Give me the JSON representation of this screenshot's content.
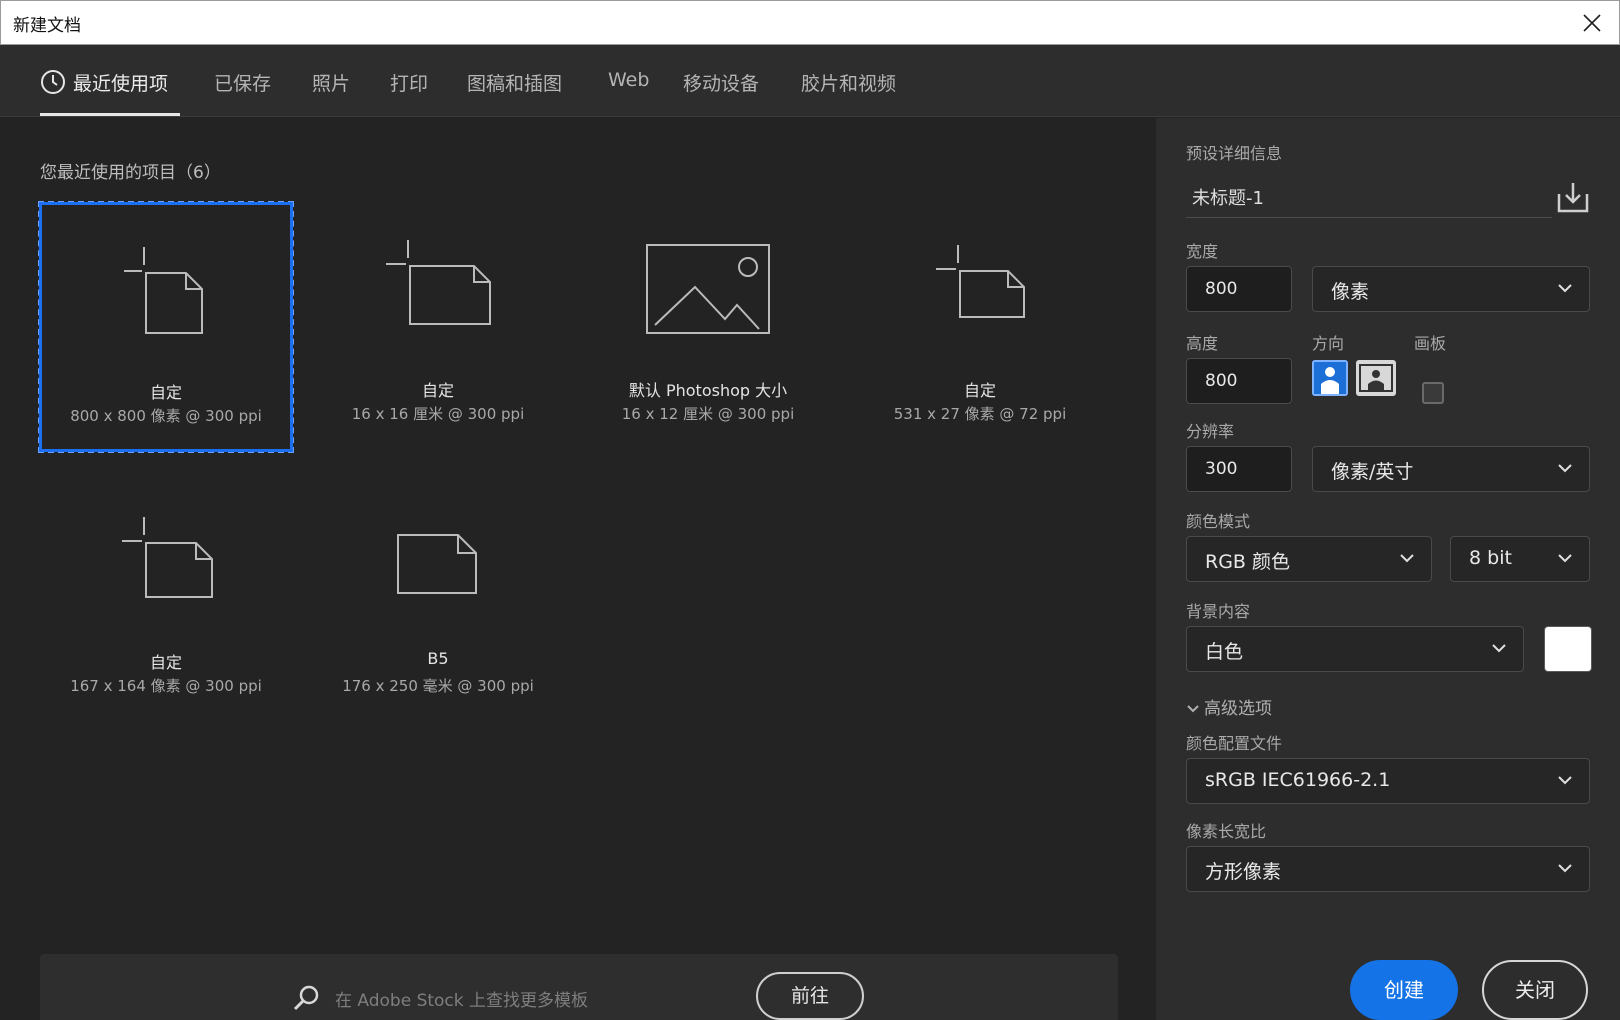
{
  "window": {
    "title": "新建文档"
  },
  "tabs": [
    "最近使用项",
    "已保存",
    "照片",
    "打印",
    "图稿和插图",
    "Web",
    "移动设备",
    "胶片和视频"
  ],
  "recent": {
    "heading": "您最近使用的项目（6）",
    "items": [
      {
        "name": "自定",
        "size": "800 x 800 像素 @ 300 ppi",
        "icon": "custom-document-icon"
      },
      {
        "name": "自定",
        "size": "16 x 16 厘米 @ 300 ppi",
        "icon": "custom-document-icon"
      },
      {
        "name": "默认 Photoshop 大小",
        "size": "16 x 12 厘米 @ 300 ppi",
        "icon": "image-placeholder-icon"
      },
      {
        "name": "自定",
        "size": "531 x 27 像素 @ 72 ppi",
        "icon": "custom-document-icon"
      },
      {
        "name": "自定",
        "size": "167 x 164 像素 @ 300 ppi",
        "icon": "custom-document-icon"
      },
      {
        "name": "B5",
        "size": "176 x 250 毫米 @ 300 ppi",
        "icon": "document-icon"
      }
    ]
  },
  "stock": {
    "placeholder": "在 Adobe Stock 上查找更多模板",
    "go_label": "前往"
  },
  "preset": {
    "heading": "预设详细信息",
    "doc_name": "未标题-1",
    "width_label": "宽度",
    "width_value": "800",
    "width_unit": "像素",
    "height_label": "高度",
    "height_value": "800",
    "orientation_label": "方向",
    "artboard_label": "画板",
    "resolution_label": "分辨率",
    "resolution_value": "300",
    "resolution_unit": "像素/英寸",
    "color_mode_label": "颜色模式",
    "color_mode": "RGB 颜色",
    "bit_depth": "8 bit",
    "background_label": "背景内容",
    "background": "白色",
    "background_color": "#ffffff",
    "advanced_label": "高级选项",
    "profile_label": "颜色配置文件",
    "profile": "sRGB IEC61966-2.1",
    "aspect_label": "像素长宽比",
    "aspect": "方形像素"
  },
  "actions": {
    "create": "创建",
    "close": "关闭"
  },
  "colors": {
    "accent": "#1473e6",
    "selection": "#1c6ff0"
  }
}
